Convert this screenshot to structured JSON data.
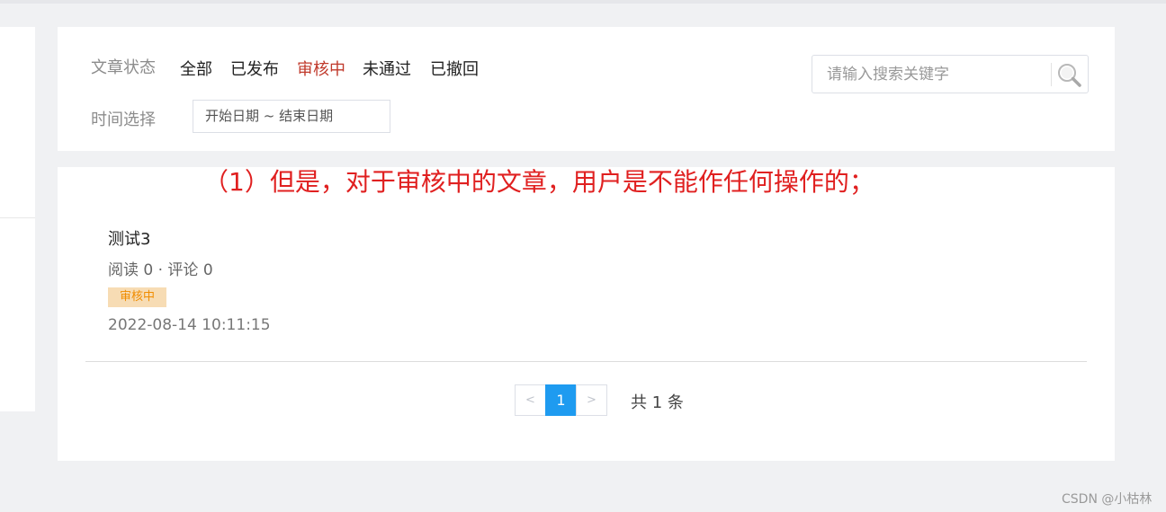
{
  "filter": {
    "status_label": "文章状态",
    "tabs": [
      {
        "label": "全部",
        "active": false
      },
      {
        "label": "已发布",
        "active": false
      },
      {
        "label": "审核中",
        "active": true
      },
      {
        "label": "未通过",
        "active": false
      },
      {
        "label": "已撤回",
        "active": false
      }
    ],
    "time_label": "时间选择",
    "date_range": "开始日期 ~ 结束日期",
    "search_placeholder": "请输入搜索关键字",
    "active_color": "#c0392b"
  },
  "annotation": "（1）但是，对于审核中的文章，用户是不能作任何操作的；",
  "article": {
    "title": "测试3",
    "meta": "阅读 0 · 评论 0",
    "status_tag": "审核中",
    "time": "2022-08-14 10:11:15"
  },
  "pagination": {
    "prev": "<",
    "page": "1",
    "next": ">",
    "total": "共 1 条"
  },
  "watermark": "CSDN @小枯林",
  "colors": {
    "accent": "#1e9bf0",
    "annotation": "#e02020",
    "tag_bg": "#f7dcb4",
    "tag_text": "#f08c00"
  }
}
